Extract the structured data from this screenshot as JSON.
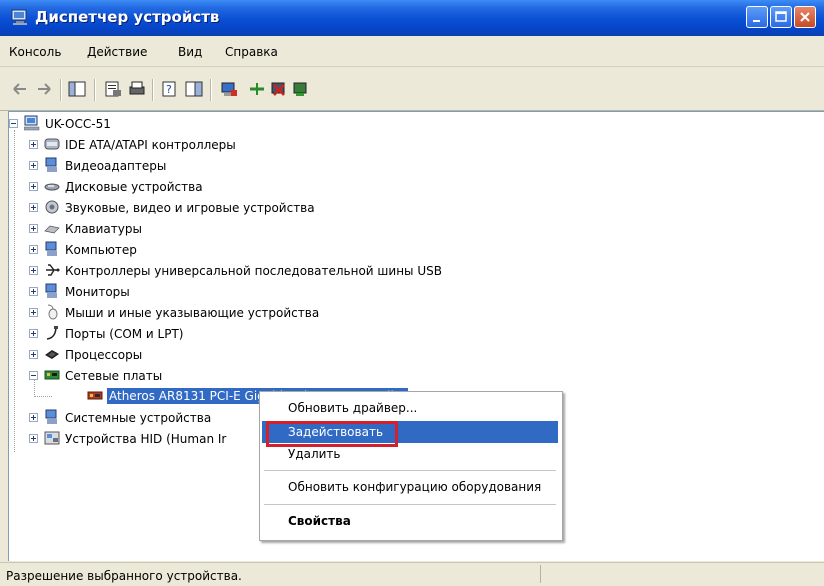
{
  "window": {
    "title": "Диспетчер устройств"
  },
  "menu": {
    "items": [
      "Консоль",
      "Действие",
      "Вид",
      "Справка"
    ]
  },
  "toolbar": {
    "icons": [
      "back-arrow-icon",
      "forward-arrow-icon",
      "console-tree-icon",
      "properties-icon",
      "print-icon",
      "help-icon",
      "show-hide-icon",
      "update-driver-icon",
      "uninstall-icon",
      "disable-icon",
      "enable-icon"
    ]
  },
  "tree": {
    "root": "UK-OCC-51",
    "items": [
      {
        "label": "IDE ATA/ATAPI контроллеры",
        "icon": "ide-controller-icon"
      },
      {
        "label": "Видеоадаптеры",
        "icon": "display-adapter-icon"
      },
      {
        "label": "Дисковые устройства",
        "icon": "disk-drive-icon"
      },
      {
        "label": "Звуковые, видео и игровые устройства",
        "icon": "sound-device-icon"
      },
      {
        "label": "Клавиатуры",
        "icon": "keyboard-icon"
      },
      {
        "label": "Компьютер",
        "icon": "computer-icon"
      },
      {
        "label": "Контроллеры универсальной последовательной шины USB",
        "icon": "usb-icon"
      },
      {
        "label": "Мониторы",
        "icon": "monitor-icon"
      },
      {
        "label": "Мыши и иные указывающие устройства",
        "icon": "mouse-icon"
      },
      {
        "label": "Порты (COM и LPT)",
        "icon": "port-icon"
      },
      {
        "label": "Процессоры",
        "icon": "processor-icon"
      },
      {
        "label": "Сетевые платы",
        "icon": "network-adapter-icon"
      },
      {
        "label": "Системные устройства",
        "icon": "system-device-icon"
      },
      {
        "label": "Устройства HID (Human Ir",
        "icon": "hid-device-icon"
      }
    ],
    "child_selected": "Atheros AR8131 PCI-E Gigabit Ethernet Controller"
  },
  "context_menu": {
    "items": [
      "Обновить драйвер...",
      "Задействовать",
      "Удалить",
      "Обновить конфигурацию оборудования",
      "Свойства"
    ],
    "highlighted_index": 1
  },
  "status": {
    "text": "Разрешение выбранного устройства."
  },
  "colors": {
    "title_blue": "#0a4fd4",
    "highlight": "#316ac5",
    "callout_red": "#d41f2d"
  }
}
